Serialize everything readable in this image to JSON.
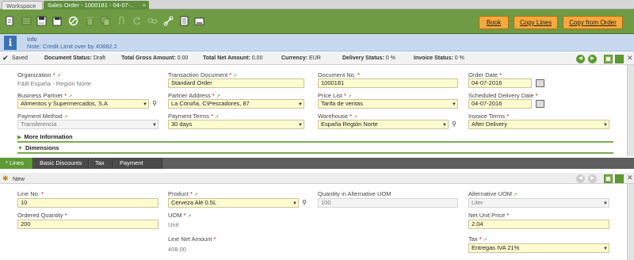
{
  "window_tabs": {
    "workspace": "Workspace",
    "active": "Sales Order - 1000181 - 04-07-...",
    "close": "×"
  },
  "toolbar": {
    "icons": [
      "new-document-icon",
      "grid-view-icon",
      "save-icon",
      "save-close-icon",
      "cancel-icon",
      "delete-icon",
      "copy-icon",
      "attachment-icon",
      "refresh-icon",
      "link-icon",
      "report-icon",
      "print-icon",
      "linked-items-icon"
    ],
    "book": "Book",
    "copy_lines": "Copy Lines",
    "copy_from_order": "Copy from Order",
    "accent": "#f5a83c"
  },
  "message": {
    "title": "Info",
    "text": "Note: Credit Limit over by 40882.2"
  },
  "status": {
    "saved": "Saved",
    "doc_status_label": "Document Status:",
    "doc_status": "Draft",
    "gross_label": "Total Gross Amount:",
    "gross": "0.00",
    "net_label": "Total Net Amount:",
    "net": "0.00",
    "currency_label": "Currency:",
    "currency": "EUR",
    "delivery_label": "Delivery Status:",
    "delivery": "0 %",
    "invoice_label": "Invoice Status:",
    "invoice": "0 %"
  },
  "header": {
    "organization": {
      "label": "Organization",
      "value": "F&B España - Región Norte"
    },
    "transaction_document": {
      "label": "Transaction Document",
      "value": "Standard Order"
    },
    "document_no": {
      "label": "Document No.",
      "value": "1000181"
    },
    "order_date": {
      "label": "Order Date",
      "value": "04-07-2016"
    },
    "business_partner": {
      "label": "Business Partner",
      "value": "Alimentos y Supermercados, S.A"
    },
    "partner_address": {
      "label": "Partner Address",
      "value": "La Coruña, C\\Pescadores, 87"
    },
    "price_list": {
      "label": "Price List",
      "value": "Tarifa de ventas"
    },
    "scheduled_delivery": {
      "label": "Scheduled Delivery Date",
      "value": "04-07-2016"
    },
    "payment_method": {
      "label": "Payment Method",
      "value": "Transferencia"
    },
    "payment_terms": {
      "label": "Payment Terms",
      "value": "30 days"
    },
    "warehouse": {
      "label": "Warehouse",
      "value": "España Región Norte"
    },
    "invoice_terms": {
      "label": "Invoice Terms",
      "value": "After Delivery"
    },
    "more_information": "More Information",
    "dimensions": "Dimensions"
  },
  "subtabs": [
    "Lines",
    "Basic Discounts",
    "Tax",
    "Payment Plan"
  ],
  "lines": {
    "new_label": "New",
    "line_no": {
      "label": "Line No.",
      "value": "10"
    },
    "product": {
      "label": "Product",
      "value": "Cerveza Ale 0.5L"
    },
    "qty_alt_uom": {
      "label": "Quantity in Alternative UOM",
      "value": "100"
    },
    "alt_uom": {
      "label": "Alternative UOM",
      "value": "Liter"
    },
    "ordered_qty": {
      "label": "Ordered Quantity",
      "value": "200"
    },
    "uom": {
      "label": "UOM",
      "value": "Unit"
    },
    "net_unit_price": {
      "label": "Net Unit Price",
      "value": "2.04"
    },
    "line_net_amount": {
      "label": "Line Net Amount",
      "value": "408.00"
    },
    "tax": {
      "label": "Tax",
      "value": "Entregas IVA 21%"
    }
  }
}
